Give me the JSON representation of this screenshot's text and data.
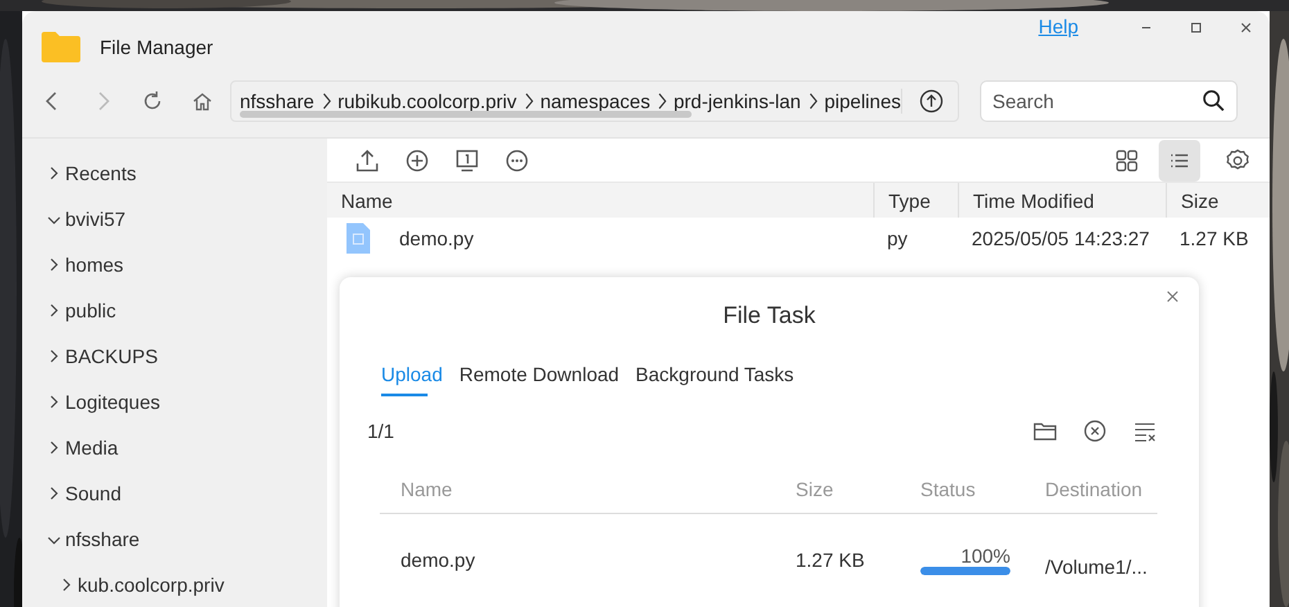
{
  "window": {
    "title": "File Manager",
    "help": "Help"
  },
  "path": {
    "segments": [
      "nfsshare",
      "rubikub.coolcorp.priv",
      "namespaces",
      "prd-jenkins-lan",
      "pipelines"
    ]
  },
  "search": {
    "placeholder": "Search"
  },
  "sidebar": {
    "items": [
      {
        "label": "Recents",
        "expanded": false
      },
      {
        "label": "bvivi57",
        "expanded": true
      },
      {
        "label": "homes",
        "expanded": false
      },
      {
        "label": "public",
        "expanded": false
      },
      {
        "label": "BACKUPS",
        "expanded": false
      },
      {
        "label": "Logiteques",
        "expanded": false
      },
      {
        "label": "Media",
        "expanded": false
      },
      {
        "label": "Sound",
        "expanded": false
      },
      {
        "label": "nfsshare",
        "expanded": true,
        "children": [
          {
            "label": "kub.coolcorp.priv",
            "expanded": false
          }
        ]
      }
    ]
  },
  "view_modes": [
    {
      "kind": "grid",
      "selected": false
    },
    {
      "kind": "list",
      "selected": true
    }
  ],
  "table": {
    "columns": [
      "Name",
      "Type",
      "Time Modified",
      "Size"
    ],
    "rows": [
      {
        "name": "demo.py",
        "type": "py",
        "modified": "2025/05/05 14:23:27",
        "size": "1.27 KB"
      }
    ]
  },
  "dialog": {
    "title": "File Task",
    "tabs": [
      {
        "label": "Upload",
        "selected": true
      },
      {
        "label": "Remote Download",
        "selected": false
      },
      {
        "label": "Background Tasks",
        "selected": false
      }
    ],
    "count": "1/1",
    "columns": [
      "Name",
      "Size",
      "Status",
      "Destination"
    ],
    "rows": [
      {
        "name": "demo.py",
        "size": "1.27 KB",
        "level": 1,
        "percent": "100%",
        "destination": "/Volume1/..."
      }
    ]
  }
}
